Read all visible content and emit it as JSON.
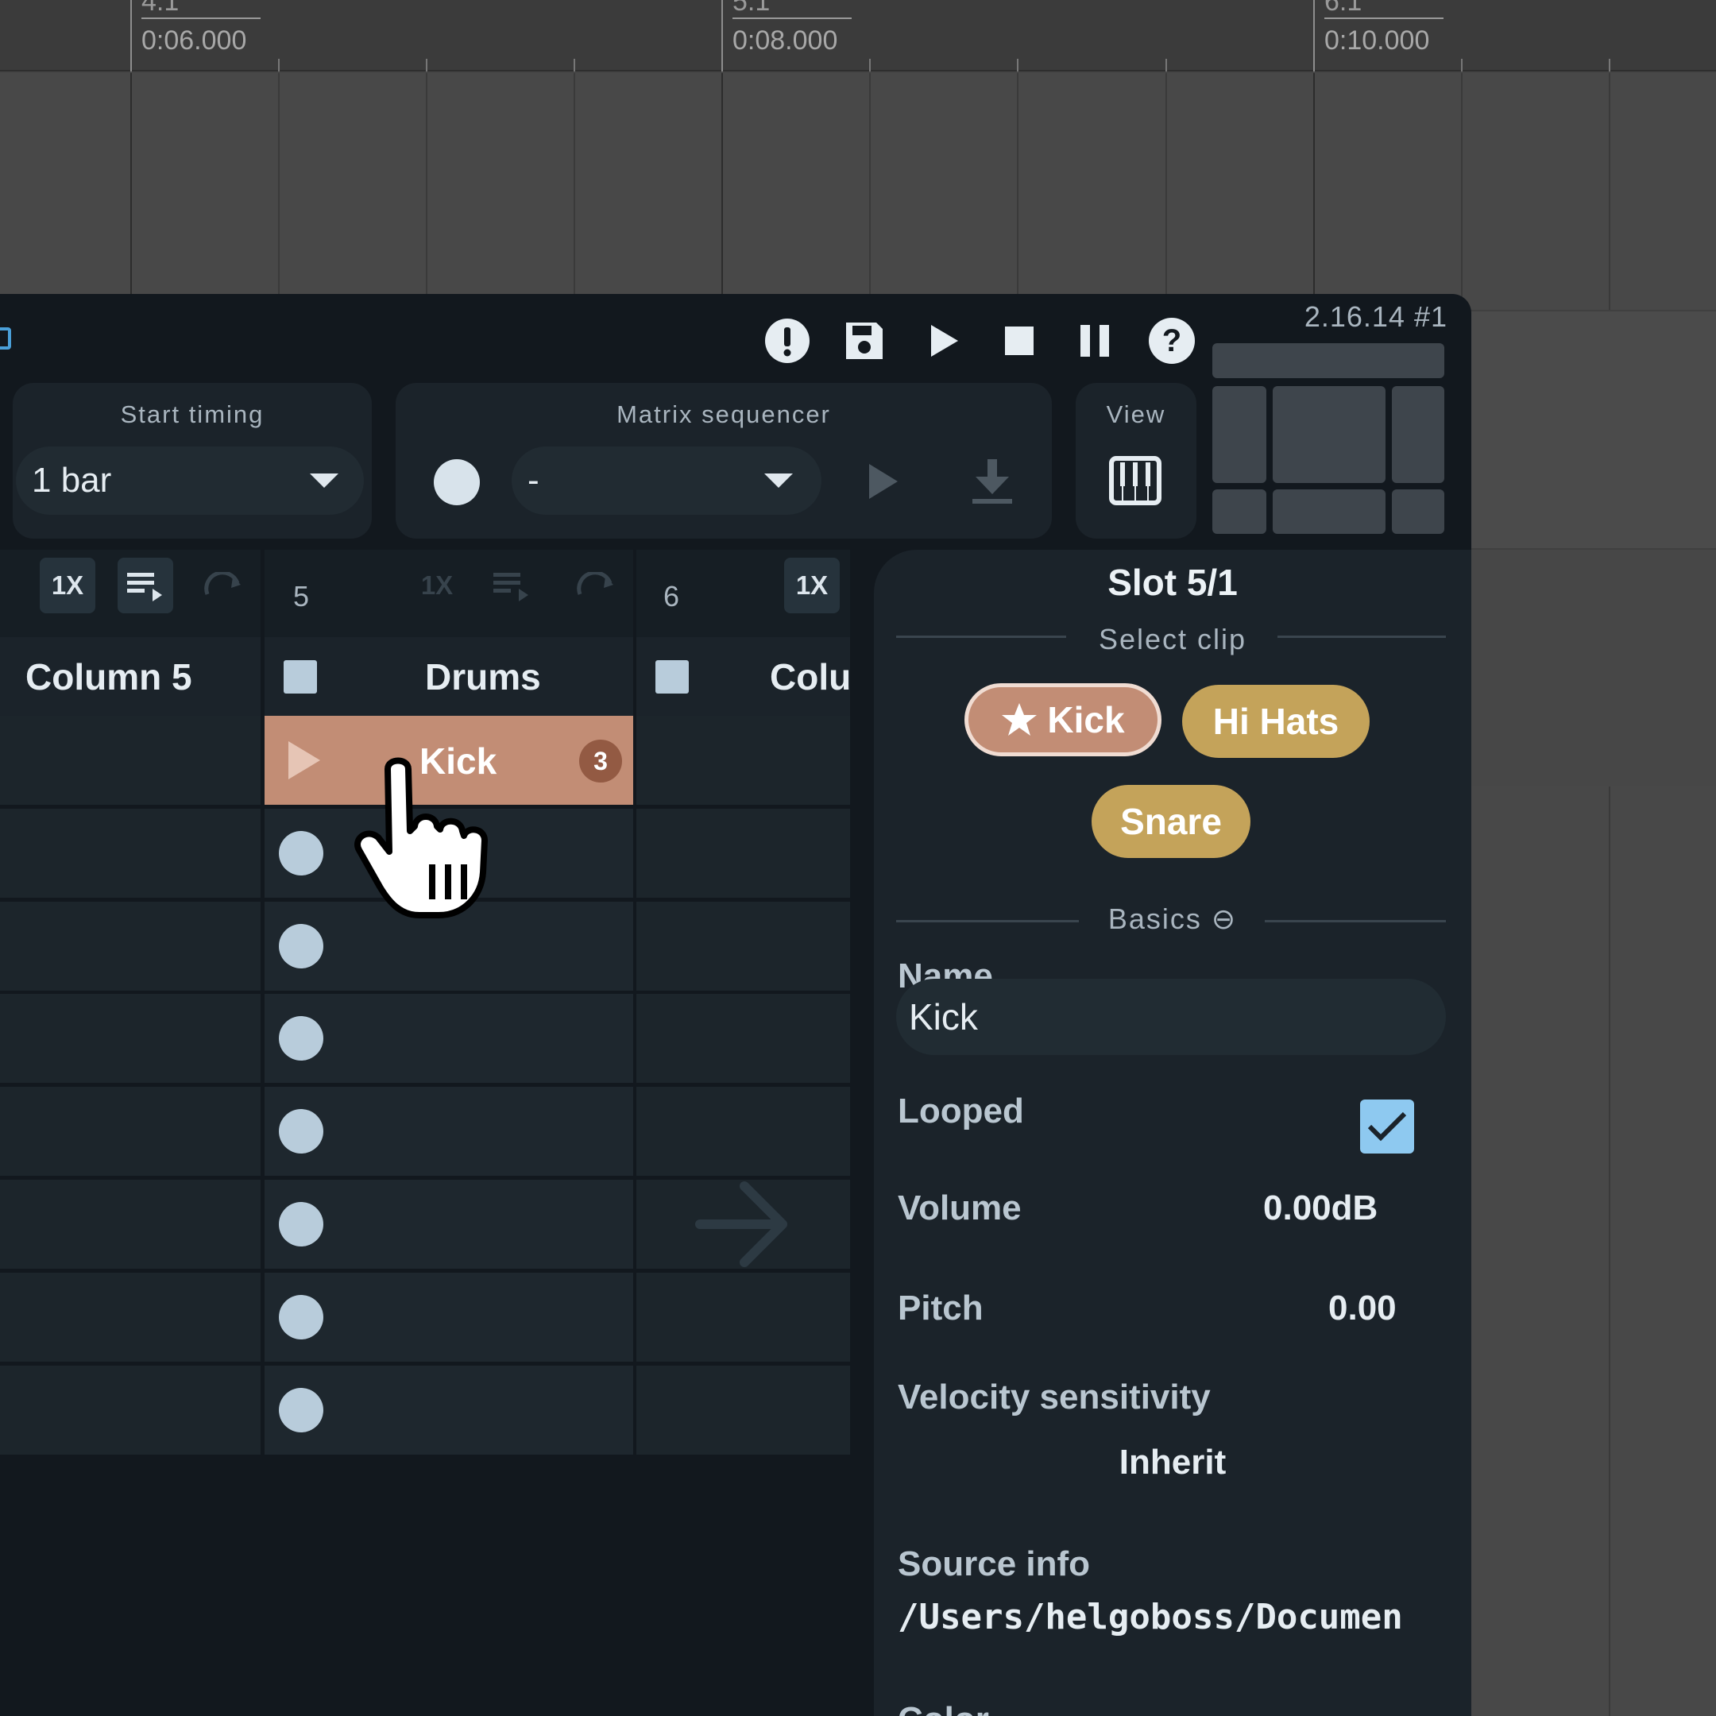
{
  "timeline": {
    "markers": [
      {
        "bar": "4.1",
        "time": "0:06.000"
      },
      {
        "bar": "5.1",
        "time": "0:08.000"
      },
      {
        "bar": "6.1",
        "time": "0:10.000"
      }
    ]
  },
  "toolbar": {
    "version": "2.16.14 #1",
    "icons": [
      "warning-icon",
      "save-icon",
      "play-icon",
      "stop-icon",
      "pause-icon",
      "help-icon"
    ]
  },
  "start_timing": {
    "title": "Start timing",
    "value": "1 bar"
  },
  "matrix_sequencer": {
    "title": "Matrix sequencer",
    "value": "-"
  },
  "view": {
    "title": "View"
  },
  "columns": [
    {
      "number": "",
      "title": "Column 5",
      "play_mode": "1X"
    },
    {
      "number": "5",
      "title": "Drums",
      "play_mode": "1X"
    },
    {
      "number": "6",
      "title": "Colu",
      "play_mode": "1X"
    }
  ],
  "kick_slot": {
    "label": "Kick",
    "count": "3"
  },
  "inspector": {
    "title": "Slot 5/1",
    "select_clip_label": "Select clip",
    "clips": [
      {
        "label": "Kick",
        "color": "#c28d75",
        "selected": true
      },
      {
        "label": "Hi Hats",
        "color": "#c4a35a"
      },
      {
        "label": "Snare",
        "color": "#c4a35a"
      }
    ],
    "basics_label": "Basics ⊖",
    "name_label": "Name",
    "name_value": "Kick",
    "looped_label": "Looped",
    "looped": true,
    "volume_label": "Volume",
    "volume_value": "0.00dB",
    "pitch_label": "Pitch",
    "pitch_value": "0.00",
    "velocity_label": "Velocity sensitivity",
    "velocity_value": "Inherit",
    "source_label": "Source info",
    "source_value": "/Users/helgoboss/Documen",
    "color_label": "Color"
  }
}
